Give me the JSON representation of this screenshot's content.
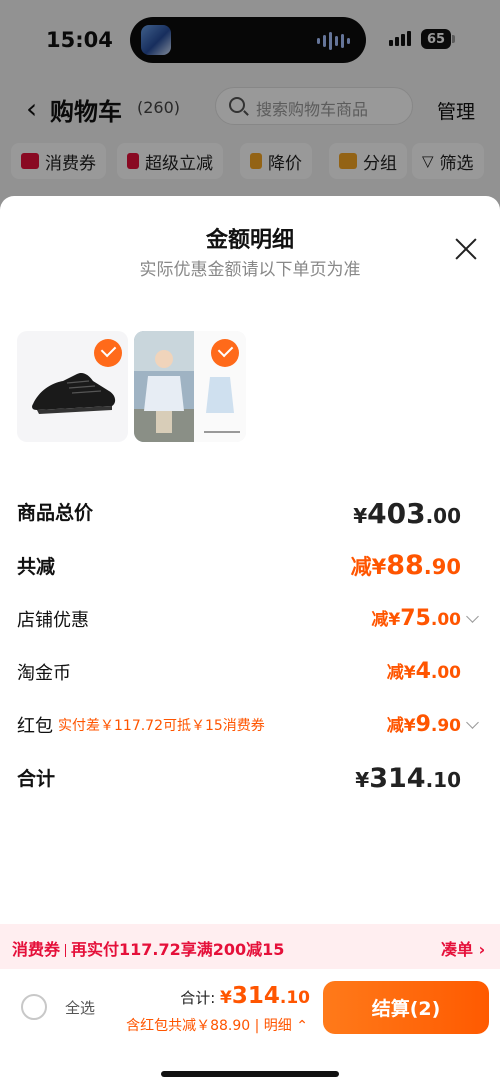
{
  "status_bar": {
    "time": "15:04",
    "battery": "65"
  },
  "nav": {
    "title": "购物车",
    "count": "(260)",
    "search_placeholder": "搜索购物车商品",
    "manage": "管理"
  },
  "chips": [
    {
      "label": "消费券",
      "icon": "coupon-icon",
      "color": "#e5103a"
    },
    {
      "label": "超级立减",
      "icon": "down-arrow-icon",
      "color": "#e5103a"
    },
    {
      "label": "降价",
      "icon": "down-arrow-icon",
      "color": "#f5a623"
    },
    {
      "label": "分组",
      "icon": "folder-icon",
      "color": "#f5a623"
    },
    {
      "label": "筛选",
      "icon": "filter-icon",
      "color": "#333333"
    }
  ],
  "sheet": {
    "title": "金额明细",
    "subtitle": "实际优惠金额请以下单页为准",
    "products": [
      {
        "name": "black-running-shoe",
        "checked": true
      },
      {
        "name": "sun-protection-jacket",
        "checked": true
      }
    ],
    "rows": {
      "subtotal": {
        "label": "商品总价",
        "symbol": "¥",
        "int": "403",
        "dec": ".00"
      },
      "discount_total": {
        "label": "共减",
        "prefix": "减¥",
        "int": "88",
        "dec": ".90"
      },
      "store_discount": {
        "label": "店铺优惠",
        "prefix": "减¥",
        "int": "75",
        "dec": ".00"
      },
      "taojinbi": {
        "label": "淘金币",
        "prefix": "减¥",
        "int": "4",
        "dec": ".00"
      },
      "red_packet": {
        "label": "红包",
        "note": "实付差￥117.72可抵￥15消费券",
        "prefix": "减¥",
        "int": "9",
        "dec": ".90"
      },
      "total": {
        "label": "合计",
        "symbol": "¥",
        "int": "314",
        "dec": ".10"
      }
    }
  },
  "promo": {
    "tag": "消费券",
    "text": "再实付117.72享满200减15",
    "link": "凑单 ›"
  },
  "footer": {
    "select_all": "全选",
    "total_label": "合计: ",
    "total_symbol": "¥",
    "total_int": "314",
    "total_dec": ".10",
    "discount_detail": "含红包共减￥88.90 | 明细",
    "checkout": "结算(2)"
  },
  "colors": {
    "accent": "#ff5500",
    "promo_red": "#e5103a",
    "checkout_orange": "#ff6a00"
  }
}
